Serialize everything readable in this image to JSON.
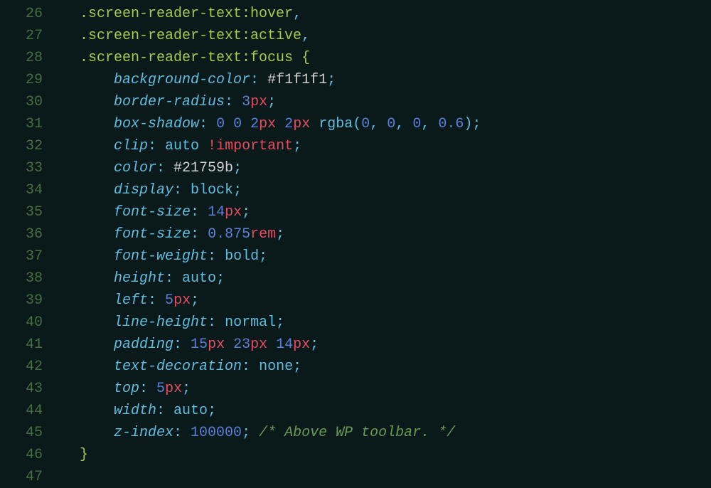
{
  "gutterStart": 26,
  "lines": {
    "l26": {
      "sel": ".screen-reader-text",
      "pseudo": ":hover",
      "tail": ","
    },
    "l27": {
      "sel": ".screen-reader-text",
      "pseudo": ":active",
      "tail": ","
    },
    "l28": {
      "sel": ".screen-reader-text",
      "pseudo": ":focus",
      "brace": " {"
    },
    "l29": {
      "prop": "background-color",
      "hex": "#f1f1f1"
    },
    "l30": {
      "prop": "border-radius",
      "num": "3",
      "unit": "px"
    },
    "l31": {
      "prop": "box-shadow",
      "z1": "0",
      "z2": "0",
      "n1": "2",
      "u1": "px",
      "n2": "2",
      "u2": "px",
      "func": "rgba",
      "a1": "0",
      "a2": "0",
      "a3": "0",
      "a4": "0.6"
    },
    "l32": {
      "prop": "clip",
      "val": "auto",
      "imp": "!important"
    },
    "l33": {
      "prop": "color",
      "hex": "#21759b"
    },
    "l34": {
      "prop": "display",
      "val": "block"
    },
    "l35": {
      "prop": "font-size",
      "num": "14",
      "unit": "px"
    },
    "l36": {
      "prop": "font-size",
      "num": "0.875",
      "unit": "rem"
    },
    "l37": {
      "prop": "font-weight",
      "val": "bold"
    },
    "l38": {
      "prop": "height",
      "val": "auto"
    },
    "l39": {
      "prop": "left",
      "num": "5",
      "unit": "px"
    },
    "l40": {
      "prop": "line-height",
      "val": "normal"
    },
    "l41": {
      "prop": "padding",
      "n1": "15",
      "u1": "px",
      "n2": "23",
      "u2": "px",
      "n3": "14",
      "u3": "px"
    },
    "l42": {
      "prop": "text-decoration",
      "val": "none"
    },
    "l43": {
      "prop": "top",
      "num": "5",
      "unit": "px"
    },
    "l44": {
      "prop": "width",
      "val": "auto"
    },
    "l45": {
      "prop": "z-index",
      "num": "100000",
      "comment": "/* Above WP toolbar. */"
    },
    "l46": {
      "brace": "}"
    }
  },
  "lineNumbers": {
    "n26": "26",
    "n27": "27",
    "n28": "28",
    "n29": "29",
    "n30": "30",
    "n31": "31",
    "n32": "32",
    "n33": "33",
    "n34": "34",
    "n35": "35",
    "n36": "36",
    "n37": "37",
    "n38": "38",
    "n39": "39",
    "n40": "40",
    "n41": "41",
    "n42": "42",
    "n43": "43",
    "n44": "44",
    "n45": "45",
    "n46": "46",
    "n47": "47"
  }
}
